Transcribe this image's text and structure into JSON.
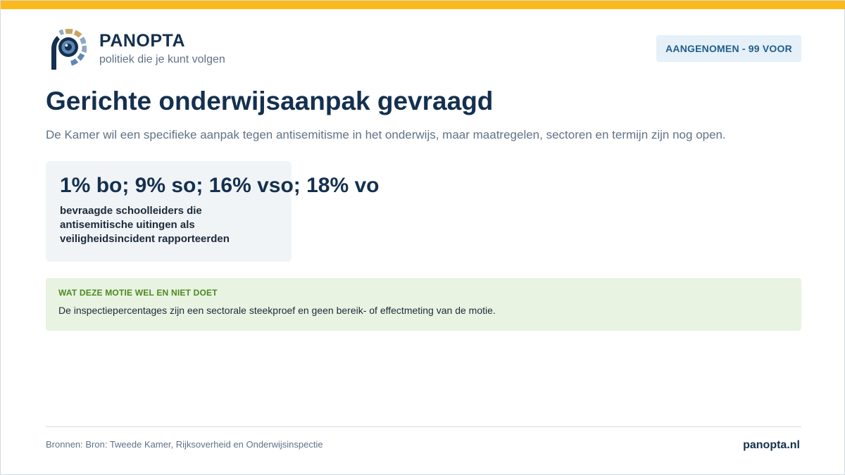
{
  "brand": {
    "name": "PANOPTA",
    "tagline": "politiek die je kunt volgen",
    "logo_icon": "panopta-eye-logo-icon"
  },
  "status": {
    "label": "AANGENOMEN - 99 VOOR"
  },
  "headline": {
    "title": "Gerichte onderwijsaanpak gevraagd",
    "subtitle": "De Kamer wil een specifieke aanpak tegen antisemitisme in het onderwijs, maar maatregelen, sectoren en termijn zijn nog open."
  },
  "stat": {
    "value": "1% bo; 9% so; 16% vso; 18% vo",
    "label": "bevraagde schoolleiders die antisemitische uitingen als veiligheidsincident rapporteerden"
  },
  "note": {
    "heading": "WAT DEZE MOTIE WEL EN NIET DOET",
    "body": "De inspectiepercentages zijn een sectorale steekproef en geen bereik- of effectmeting van de motie."
  },
  "footer": {
    "sources": "Bronnen: Bron: Tweede Kamer, Rijksoverheid en Onderwijsinspectie",
    "site": "panopta.nl"
  },
  "colors": {
    "accent_bar": "#fbb91c",
    "primary_text": "#14304f",
    "muted_text": "#5f7387",
    "badge_bg": "#e5f0f8",
    "badge_text": "#1f5e8c",
    "note_bg": "#e8f3e2",
    "note_heading": "#4a8a1e"
  }
}
